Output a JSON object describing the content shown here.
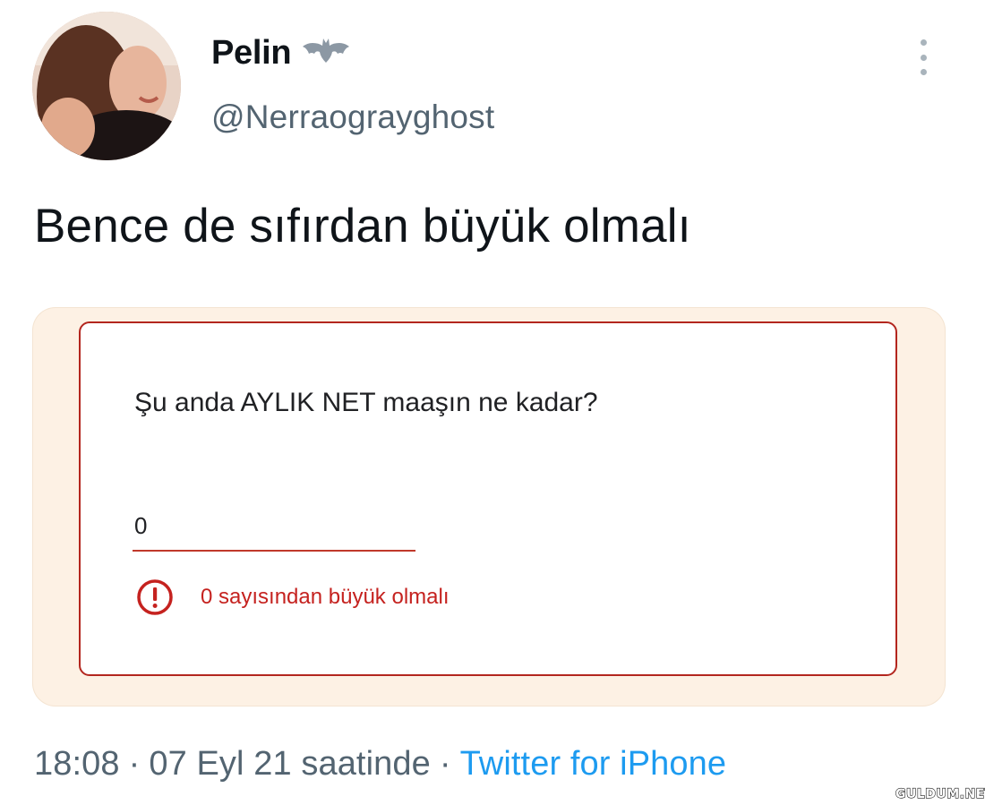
{
  "tweet": {
    "author": {
      "display_name": "Pelin",
      "badge_icon": "bat-icon",
      "handle": "@Nerraograyghost"
    },
    "text": "Bence de sıfırdan büyük olmalı",
    "media": {
      "question": "Şu anda AYLIK NET maaşın ne kadar?",
      "answer_value": "0",
      "error_icon": "exclamation-circle-icon",
      "error_message": "0 sayısından büyük olmalı",
      "error_color": "#c5221f"
    },
    "footer": {
      "time": "18:08",
      "separator": "·",
      "date": "07 Eyl 21 saatinde",
      "source": "Twitter for iPhone"
    },
    "more_icon": "more-vertical-icon"
  },
  "colors": {
    "text": "#0f1419",
    "secondary": "#536471",
    "link": "#1d9bf0",
    "media_background": "#fdf1e4",
    "error_border": "#b3261e"
  },
  "watermark": "GULDUM.NET"
}
